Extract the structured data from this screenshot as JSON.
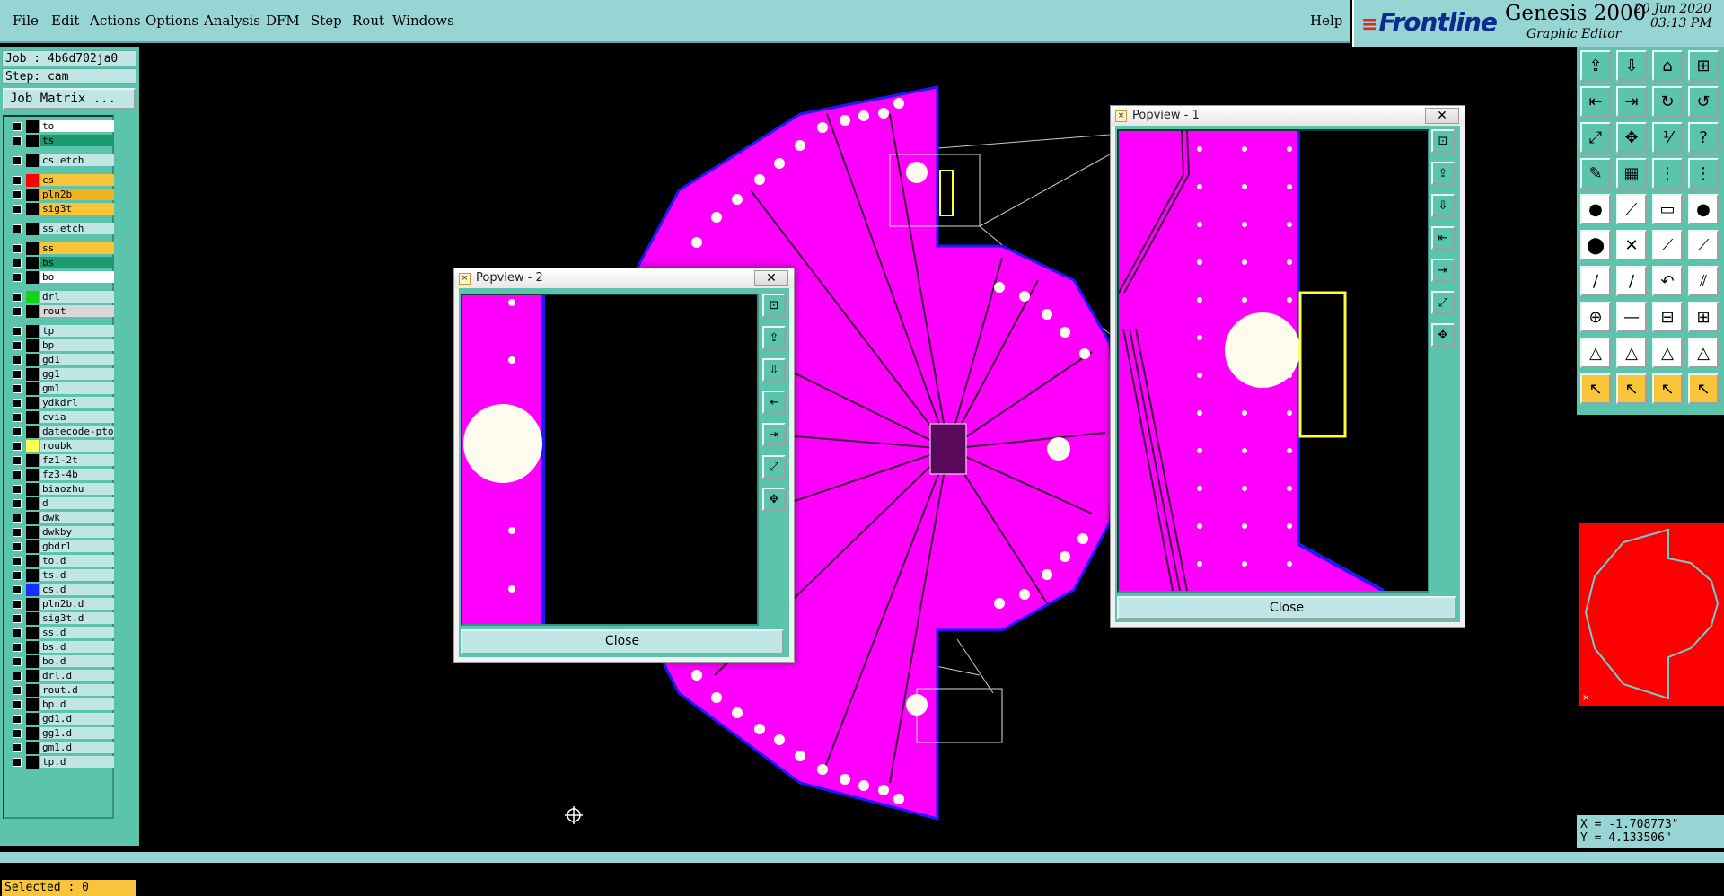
{
  "menu": {
    "file": "File",
    "edit": "Edit",
    "actions": "Actions",
    "options": "Options",
    "analysis": "Analysis",
    "dfm": "DFM",
    "step": "Step",
    "rout": "Rout",
    "windows": "Windows",
    "help": "Help"
  },
  "brand": {
    "logo": "Frontline",
    "product": "Genesis 2000",
    "subtitle": "Graphic Editor",
    "date": "20 Jun 2020",
    "time": "03:13 PM"
  },
  "job": {
    "line": "Job : 4b6d702ja0",
    "step": "Step: cam",
    "matrix_button": "Job Matrix ..."
  },
  "layers": [
    {
      "name": "to",
      "color": "#ffffff",
      "box": "#000000"
    },
    {
      "name": "ts",
      "color": "#1a9c6f",
      "box": "#000000"
    },
    {
      "name": "cs.etch",
      "color": "#bfe6e5",
      "box": "#000000"
    },
    {
      "name": "cs",
      "color": "#f7c43a",
      "box": "#ff0000"
    },
    {
      "name": "pln2b",
      "color": "#f0b31e",
      "box": "#000000"
    },
    {
      "name": "sig3t",
      "color": "#f7c43a",
      "box": "#000000"
    },
    {
      "name": "ss.etch",
      "color": "#bfe6e5",
      "box": "#000000"
    },
    {
      "name": "ss",
      "color": "#f7c43a",
      "box": "#000000"
    },
    {
      "name": "bs",
      "color": "#1a9c6f",
      "box": "#000000"
    },
    {
      "name": "bo",
      "color": "#ffffff",
      "box": "#000000"
    },
    {
      "name": "drl",
      "color": "#bfe6e5",
      "box": "#16d11a"
    },
    {
      "name": "rout",
      "color": "#d7d7d7",
      "box": "#000000"
    },
    {
      "name": "tp",
      "color": "#bfe6e5",
      "box": "#000000"
    },
    {
      "name": "bp",
      "color": "#bfe6e5",
      "box": "#000000"
    },
    {
      "name": "gd1",
      "color": "#bfe6e5",
      "box": "#000000"
    },
    {
      "name": "gg1",
      "color": "#bfe6e5",
      "box": "#000000"
    },
    {
      "name": "gm1",
      "color": "#bfe6e5",
      "box": "#000000"
    },
    {
      "name": "ydkdrl",
      "color": "#bfe6e5",
      "box": "#000000"
    },
    {
      "name": "cvia",
      "color": "#bfe6e5",
      "box": "#000000"
    },
    {
      "name": "datecode-pto",
      "color": "#bfe6e5",
      "box": "#000000"
    },
    {
      "name": "roubk",
      "color": "#bfe6e5",
      "box": "#ffff4d"
    },
    {
      "name": "fz1-2t",
      "color": "#bfe6e5",
      "box": "#000000"
    },
    {
      "name": "fz3-4b",
      "color": "#bfe6e5",
      "box": "#000000"
    },
    {
      "name": "biaozhu",
      "color": "#bfe6e5",
      "box": "#000000"
    },
    {
      "name": "d",
      "color": "#bfe6e5",
      "box": "#000000"
    },
    {
      "name": "dwk",
      "color": "#bfe6e5",
      "box": "#000000"
    },
    {
      "name": "dwkby",
      "color": "#bfe6e5",
      "box": "#000000"
    },
    {
      "name": "gbdrl",
      "color": "#bfe6e5",
      "box": "#000000"
    },
    {
      "name": "to.d",
      "color": "#bfe6e5",
      "box": "#000000"
    },
    {
      "name": "ts.d",
      "color": "#bfe6e5",
      "box": "#000000"
    },
    {
      "name": "cs.d",
      "color": "#bfe6e5",
      "box": "#1a2dff"
    },
    {
      "name": "pln2b.d",
      "color": "#bfe6e5",
      "box": "#000000"
    },
    {
      "name": "sig3t.d",
      "color": "#bfe6e5",
      "box": "#000000"
    },
    {
      "name": "ss.d",
      "color": "#bfe6e5",
      "box": "#000000"
    },
    {
      "name": "bs.d",
      "color": "#bfe6e5",
      "box": "#000000"
    },
    {
      "name": "bo.d",
      "color": "#bfe6e5",
      "box": "#000000"
    },
    {
      "name": "drl.d",
      "color": "#bfe6e5",
      "box": "#000000"
    },
    {
      "name": "rout.d",
      "color": "#bfe6e5",
      "box": "#000000"
    },
    {
      "name": "bp.d",
      "color": "#bfe6e5",
      "box": "#000000"
    },
    {
      "name": "gd1.d",
      "color": "#bfe6e5",
      "box": "#000000"
    },
    {
      "name": "gg1.d",
      "color": "#bfe6e5",
      "box": "#000000"
    },
    {
      "name": "gm1.d",
      "color": "#bfe6e5",
      "box": "#000000"
    },
    {
      "name": "tp.d",
      "color": "#bfe6e5",
      "box": "#000000"
    }
  ],
  "selected": "Selected : 0",
  "popview1": {
    "title": "Popview - 1",
    "close": "Close"
  },
  "popview2": {
    "title": "Popview - 2",
    "close": "Close"
  },
  "coords": {
    "x": "X = -1.708773\"",
    "y": "Y = 4.133506\""
  },
  "colors": {
    "board": "#ff00ff",
    "edge": "#1a1aff",
    "pad": "#fffbee",
    "panel": "#5cc3ac",
    "bar": "#97d5d4",
    "highlight": "#ffff33"
  }
}
